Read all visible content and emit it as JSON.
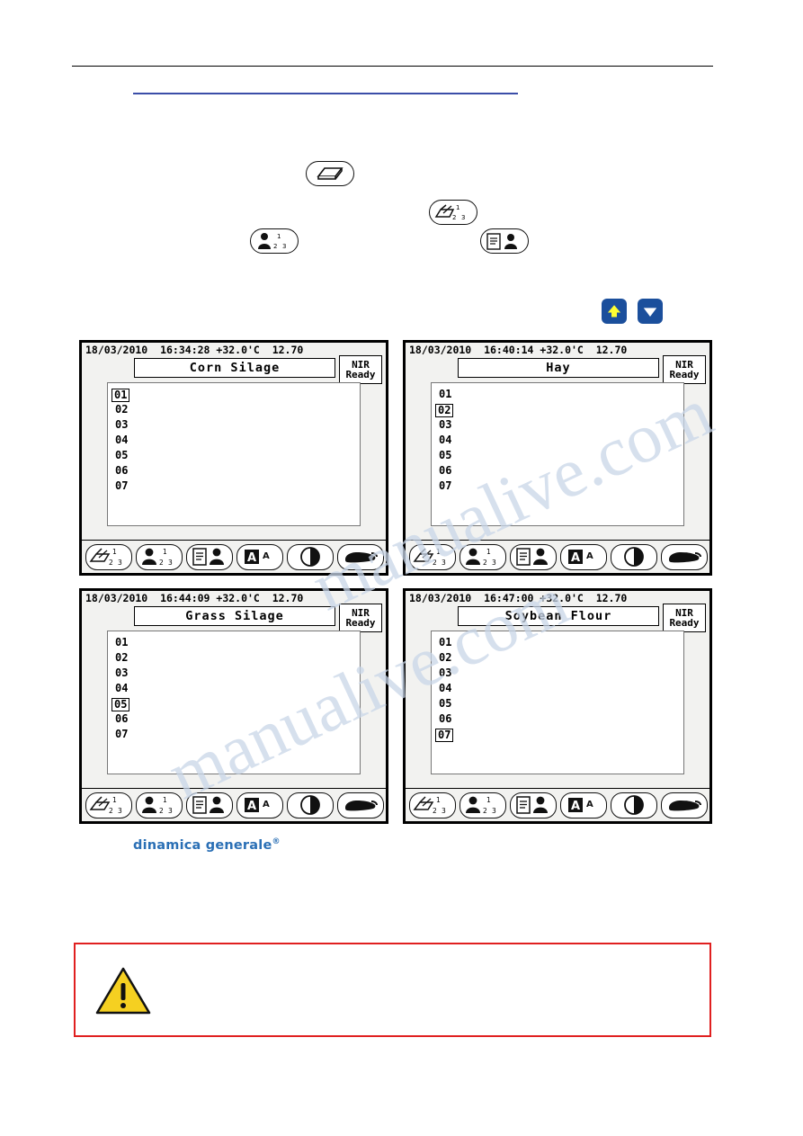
{
  "page": {
    "logo_text": "dinamica generale",
    "logo_sup": "®",
    "watermark": "manualive.com"
  },
  "inline_keys": [
    {
      "name": "eraser-key",
      "icon": "eraser-icon"
    },
    {
      "name": "sample-analysis-key",
      "icon": "scoop-123-icon"
    },
    {
      "name": "operator-key",
      "icon": "person-123-icon"
    },
    {
      "name": "report-key",
      "icon": "document-person-icon"
    }
  ],
  "arrow_keys": [
    {
      "name": "up-key",
      "icon": "arrow-up-icon",
      "color": "#1b4f9c"
    },
    {
      "name": "down-key",
      "icon": "arrow-down-icon",
      "color": "#1b4f9c"
    }
  ],
  "screens": [
    {
      "id": "screen-corn-silage",
      "status": "18/03/2010  16:34:28 +32.0'C  12.70",
      "title": "Corn Silage",
      "nir_label": "NIR",
      "nir_status": "Ready",
      "items": [
        "01",
        "02",
        "03",
        "04",
        "05",
        "06",
        "07"
      ],
      "selected_index": 0,
      "softkeys": [
        {
          "name": "softkey-sample",
          "icon": "scoop-123-icon",
          "highlighted": false
        },
        {
          "name": "softkey-operator",
          "icon": "person-123-icon",
          "highlighted": false
        },
        {
          "name": "softkey-report",
          "icon": "document-person-icon",
          "highlighted": false
        },
        {
          "name": "softkey-font",
          "icon": "font-aa-icon",
          "highlighted": true
        },
        {
          "name": "softkey-contrast",
          "icon": "contrast-icon",
          "highlighted": false
        },
        {
          "name": "softkey-exit",
          "icon": "hand-exit-icon",
          "highlighted": false
        }
      ]
    },
    {
      "id": "screen-hay",
      "status": "18/03/2010  16:40:14 +32.0'C  12.70",
      "title": "Hay",
      "nir_label": "NIR",
      "nir_status": "Ready",
      "items": [
        "01",
        "02",
        "03",
        "04",
        "05",
        "06",
        "07"
      ],
      "selected_index": 1,
      "softkeys": [
        {
          "name": "softkey-sample",
          "icon": "scoop-123-icon",
          "highlighted": true
        },
        {
          "name": "softkey-operator",
          "icon": "person-123-icon",
          "highlighted": false
        },
        {
          "name": "softkey-report",
          "icon": "document-person-icon",
          "highlighted": false
        },
        {
          "name": "softkey-font",
          "icon": "font-aa-icon",
          "highlighted": true
        },
        {
          "name": "softkey-contrast",
          "icon": "contrast-icon",
          "highlighted": false
        },
        {
          "name": "softkey-exit",
          "icon": "hand-exit-icon",
          "highlighted": false
        }
      ]
    },
    {
      "id": "screen-grass-silage",
      "status": "18/03/2010  16:44:09 +32.0'C  12.70",
      "title": "Grass Silage",
      "nir_label": "NIR",
      "nir_status": "Ready",
      "items": [
        "01",
        "02",
        "03",
        "04",
        "05",
        "06",
        "07"
      ],
      "selected_index": 4,
      "softkeys": [
        {
          "name": "softkey-sample",
          "icon": "scoop-123-icon",
          "highlighted": true
        },
        {
          "name": "softkey-operator",
          "icon": "person-123-icon",
          "highlighted": true
        },
        {
          "name": "softkey-report",
          "icon": "document-person-icon",
          "highlighted": false
        },
        {
          "name": "softkey-font",
          "icon": "font-aa-icon",
          "highlighted": true
        },
        {
          "name": "softkey-contrast",
          "icon": "contrast-icon",
          "highlighted": false
        },
        {
          "name": "softkey-exit",
          "icon": "hand-exit-icon",
          "highlighted": false
        }
      ]
    },
    {
      "id": "screen-soybean-flour",
      "status": "18/03/2010  16:47:00 +32.0'C  12.70",
      "title": "Soybean Flour",
      "nir_label": "NIR",
      "nir_status": "Ready",
      "items": [
        "01",
        "02",
        "03",
        "04",
        "05",
        "06",
        "07"
      ],
      "selected_index": 6,
      "softkeys": [
        {
          "name": "softkey-sample",
          "icon": "scoop-123-icon",
          "highlighted": false
        },
        {
          "name": "softkey-operator",
          "icon": "person-123-icon",
          "highlighted": false
        },
        {
          "name": "softkey-report",
          "icon": "document-person-icon",
          "highlighted": false
        },
        {
          "name": "softkey-font",
          "icon": "font-aa-icon",
          "highlighted": true
        },
        {
          "name": "softkey-contrast",
          "icon": "contrast-icon",
          "highlighted": false
        },
        {
          "name": "softkey-exit",
          "icon": "hand-exit-icon",
          "highlighted": false
        }
      ]
    }
  ],
  "warning": {
    "name": "warning-box",
    "icon": "warning-triangle-icon",
    "border_color": "#e02020"
  }
}
